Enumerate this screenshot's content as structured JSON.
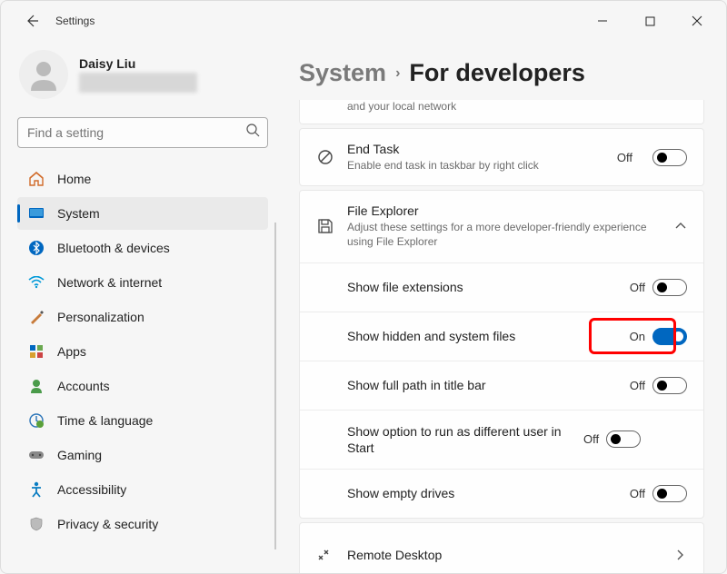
{
  "titlebar": {
    "app_name": "Settings"
  },
  "profile": {
    "name": "Daisy Liu"
  },
  "search": {
    "placeholder": "Find a setting"
  },
  "sidebar": {
    "items": [
      {
        "label": "Home"
      },
      {
        "label": "System"
      },
      {
        "label": "Bluetooth & devices"
      },
      {
        "label": "Network & internet"
      },
      {
        "label": "Personalization"
      },
      {
        "label": "Apps"
      },
      {
        "label": "Accounts"
      },
      {
        "label": "Time & language"
      },
      {
        "label": "Gaming"
      },
      {
        "label": "Accessibility"
      },
      {
        "label": "Privacy & security"
      }
    ]
  },
  "breadcrumb": {
    "parent": "System",
    "current": "For developers"
  },
  "panels": {
    "partial_top": {
      "subtitle_fragment": "and your local network"
    },
    "end_task": {
      "title": "End Task",
      "subtitle": "Enable end task in taskbar by right click",
      "state": "Off"
    },
    "file_explorer": {
      "title": "File Explorer",
      "subtitle": "Adjust these settings for a more developer-friendly experience using File Explorer",
      "items": [
        {
          "title": "Show file extensions",
          "state": "Off"
        },
        {
          "title": "Show hidden and system files",
          "state": "On"
        },
        {
          "title": "Show full path in title bar",
          "state": "Off"
        },
        {
          "title": "Show option to run as different user in Start",
          "state": "Off"
        },
        {
          "title": "Show empty drives",
          "state": "Off"
        }
      ]
    },
    "remote_desktop": {
      "title": "Remote Desktop"
    }
  },
  "toggle_states": {
    "on": "On",
    "off": "Off"
  }
}
